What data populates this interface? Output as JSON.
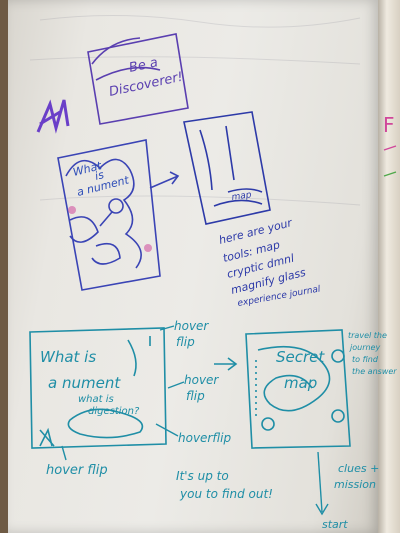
{
  "colors": {
    "purple_ink": "#5a3fb0",
    "blue_ink": "#2d4db8",
    "teal_ink": "#1f8ea6",
    "pink_ink": "#d0479a",
    "green_ink": "#4fa84a"
  },
  "top_sketch": {
    "box_text_line1": "Be a",
    "box_text_line2": "Discoverer!",
    "map_text_1": "What",
    "map_text_2": "is",
    "map_text_3": "a nument"
  },
  "tools_sketch": {
    "label": "map",
    "caption_line1": "here are your",
    "caption_line2": "tools: map",
    "caption_line3": "cryptic dmnl",
    "caption_line4": "magnify glass",
    "caption_line5": "experience journal"
  },
  "bottom_left": {
    "title_line1": "What is",
    "title_line2": "a nument",
    "sub_line1": "what is",
    "sub_line2": "digestion?",
    "note_top_line1": "hover",
    "note_top_line2": "flip",
    "note_mid_line1": "hover",
    "note_mid_line2": "flip",
    "note_low": "hoverflip",
    "bottom_label": "hover flip",
    "prompt_line1": "It's up to",
    "prompt_line2": "you to find out!"
  },
  "bottom_right": {
    "title_line1": "Secret",
    "title_line2": "map",
    "side_note_line1": "travel the",
    "side_note_line2": "journey",
    "side_note_line3": "to find",
    "side_note_line4": "the answer",
    "clues_line1": "clues +",
    "clues_line2": "mission",
    "start_label": "start"
  },
  "edge_letter": "F"
}
